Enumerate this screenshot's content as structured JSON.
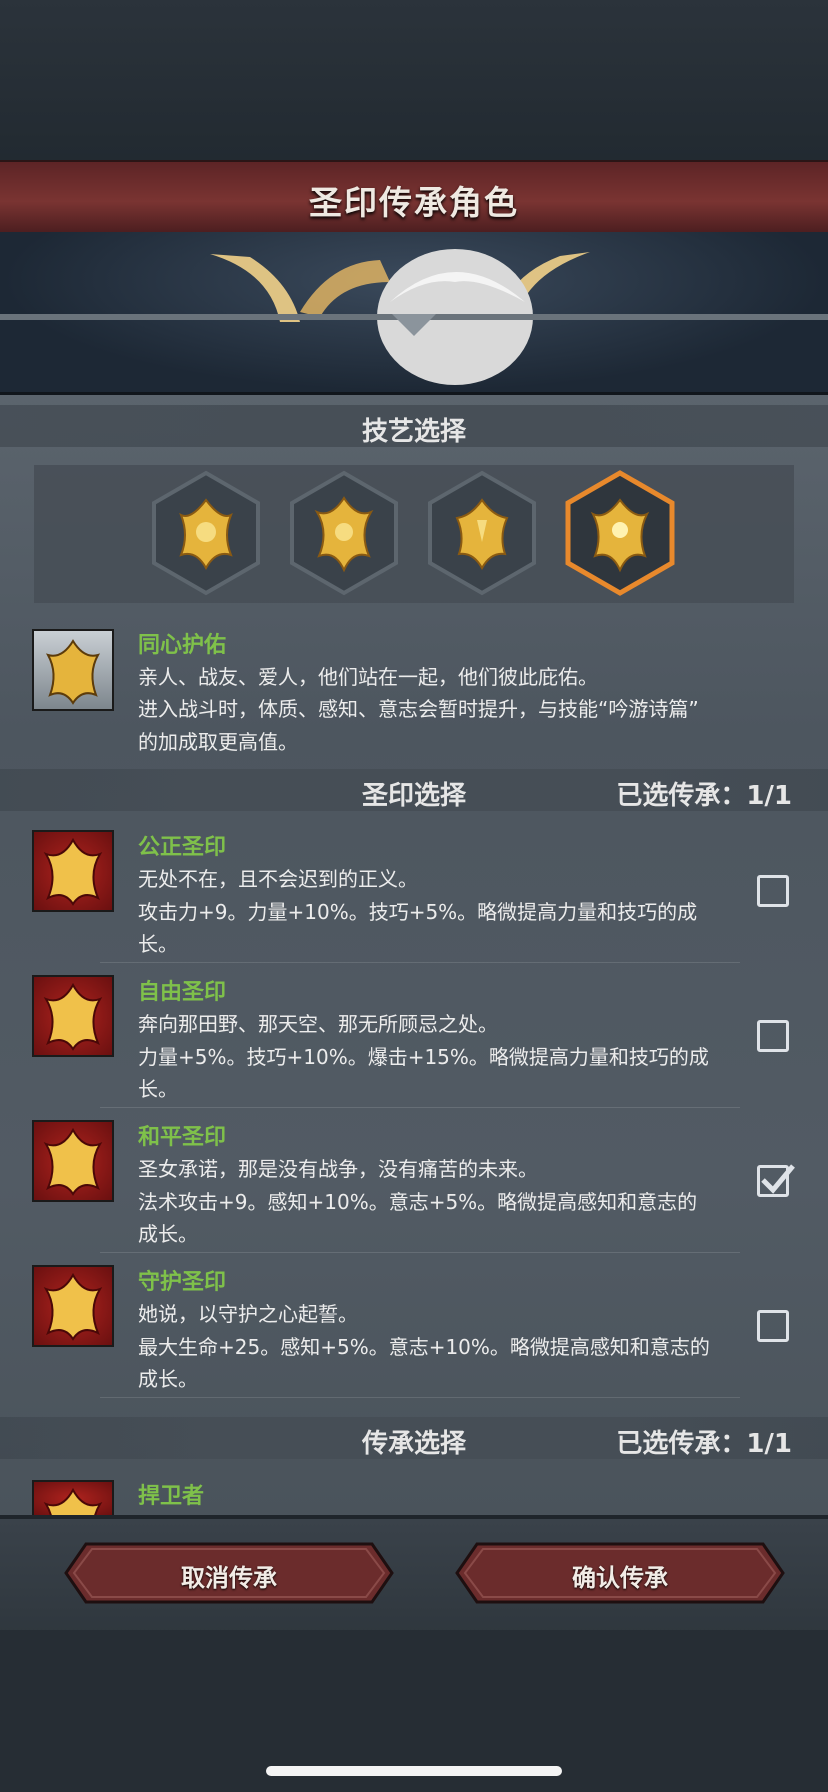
{
  "title": "圣印传承角色",
  "skill_section": {
    "heading": "技艺选择",
    "selected_index": 3
  },
  "skill_desc": {
    "name": "同心护佑",
    "lines": [
      "亲人、战友、爱人，他们站在一起，他们彼此庇佑。",
      "进入战斗时，体质、感知、意志会暂时提升，与技能“吟游诗篇”",
      "的加成取更高值。"
    ]
  },
  "seal_section": {
    "heading": "圣印选择",
    "count_label": "已选传承：1/1"
  },
  "seals": [
    {
      "name": "公正圣印",
      "lines": [
        "无处不在，且不会迟到的正义。",
        "攻击力+9。力量+10%。技巧+5%。略微提高力量和技巧的成",
        "长。"
      ],
      "checked": false
    },
    {
      "name": "自由圣印",
      "lines": [
        "奔向那田野、那天空、那无所顾忌之处。",
        "力量+5%。技巧+10%。爆击+15%。略微提高力量和技巧的成",
        "长。"
      ],
      "checked": false
    },
    {
      "name": "和平圣印",
      "lines": [
        "圣女承诺，那是没有战争，没有痛苦的未来。",
        "法术攻击+9。感知+10%。意志+5%。略微提高感知和意志的",
        "成长。"
      ],
      "checked": true
    },
    {
      "name": "守护圣印",
      "lines": [
        "她说，以守护之心起誓。",
        "最大生命+25。感知+5%。意志+10%。略微提高感知和意志的",
        "成长。"
      ],
      "checked": false
    }
  ],
  "heritage_section": {
    "heading": "传承选择",
    "count_label": "已选传承：1/1"
  },
  "heritage_item": {
    "name": "捍卫者"
  },
  "buttons": {
    "cancel": "取消传承",
    "confirm": "确认传承"
  },
  "colors": {
    "accent_green": "#7fc14a",
    "title_red": "#7a3432",
    "selected_orange": "#e8892c"
  }
}
